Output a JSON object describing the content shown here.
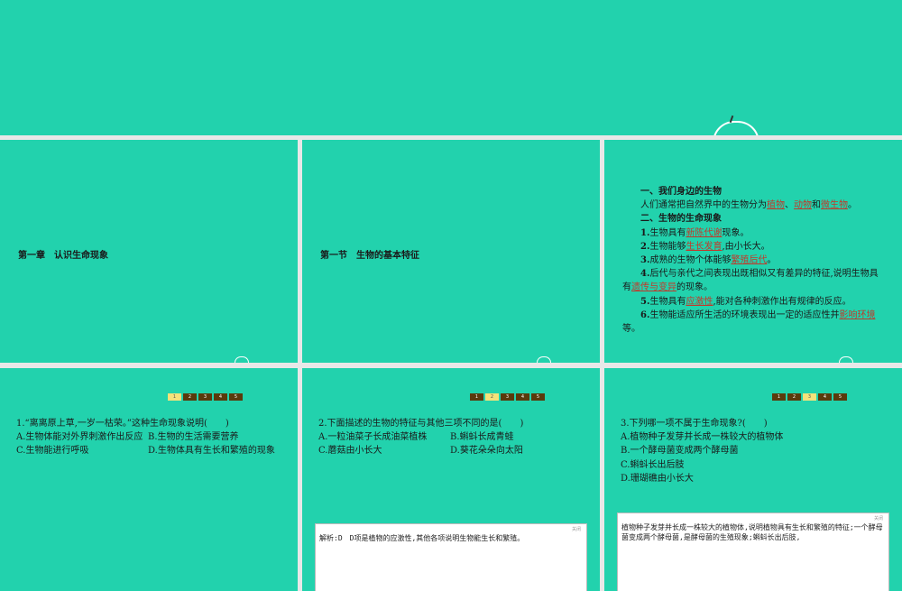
{
  "slide1": {
    "title": "第一章　认识生命现象"
  },
  "slide2": {
    "title": "第一节　生物的基本特征"
  },
  "slide3": {
    "head1": "一、我们身边的生物",
    "line1_pre": "人们通常把自然界中的生物分为",
    "ans_plant": "植物",
    "sep1": "、",
    "ans_animal": "动物",
    "sep2": "和",
    "ans_micro": "微生物",
    "end1": "。",
    "head2": "二、生物的生命现象",
    "p1_num": "1.",
    "p1_pre": "生物具有",
    "p1_ans": "新陈代谢",
    "p1_post": "现象。",
    "p2_num": "2.",
    "p2_pre": "生物能够",
    "p2_ans": "生长发育",
    "p2_post": ",由小长大。",
    "p3_num": "3.",
    "p3_pre": "成熟的生物个体能够",
    "p3_ans": "繁殖后代",
    "p3_post": "。",
    "p4_num": "4.",
    "p4_pre": "后代与亲代之间表现出既相似又有差异的特征,说明生物具",
    "p4_cont_pre": "有",
    "p4_ans": "遗传与变异",
    "p4_post": "的现象。",
    "p5_num": "5.",
    "p5_pre": "生物具有",
    "p5_ans": "应激性",
    "p5_post": ",能对各种刺激作出有规律的反应。",
    "p6_num": "6.",
    "p6_pre": "生物能适应所生活的环境表现出一定的适应性并",
    "p6_ans": "影响环境",
    "p6_cont": "等。"
  },
  "pager": [
    "1",
    "2",
    "3",
    "4",
    "5"
  ],
  "q1": {
    "stem": "1.“离离原上草,一岁一枯荣。”这种生命现象说明(　　)",
    "a": "A.生物体能对外界刺激作出反应",
    "b": "B.生物的生活需要营养",
    "c": "C.生物能进行呼吸",
    "d": "D.生物体具有生长和繁殖的现象"
  },
  "q2": {
    "stem": "2.下面描述的生物的特征与其他三项不同的是(　　)",
    "a": "A.一粒油菜子长成油菜植株",
    "b": "B.蝌蚪长成青蛙",
    "c": "C.蘑菇由小长大",
    "d": "D.葵花朵朵向太阳"
  },
  "q3": {
    "stem": "3.下列哪一项不属于生命现象?(　　)",
    "a": "A.植物种子发芽并长成一株较大的植物体",
    "b": "B.一个酵母菌变成两个酵母菌",
    "c": "C.蝌蚪长出后肢",
    "d": "D.珊瑚礁由小长大"
  },
  "panel2": {
    "tag": "关闭",
    "text": "解析:D　D项是植物的应激性,其他各项说明生物能生长和繁殖。"
  },
  "panel3": {
    "tag": "关闭",
    "text": "植物种子发芽并长成一株较大的植物体,说明植物具有生长和繁殖的特征;一个酵母菌变成两个酵母菌,是酵母菌的生殖现象;蝌蚪长出后肢,"
  }
}
